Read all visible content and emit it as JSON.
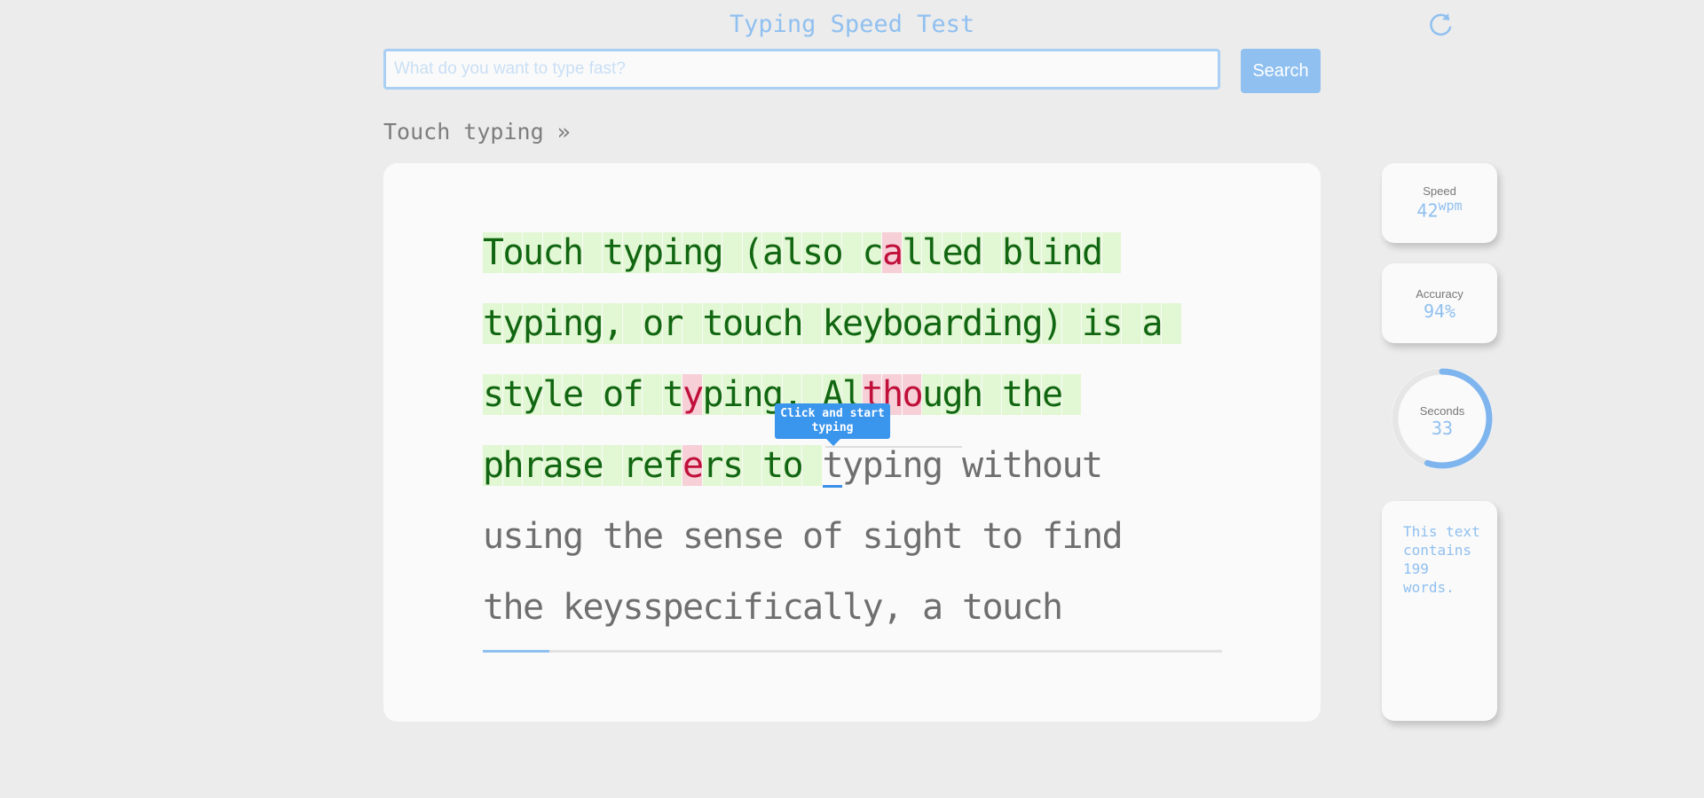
{
  "app": {
    "title": "Typing Speed Test"
  },
  "search": {
    "placeholder": "What do you want to type fast?",
    "value": "",
    "button_label": "Search"
  },
  "breadcrumb": {
    "label": "Touch typing »"
  },
  "typing": {
    "lines": [
      "Touch typing (also called blind ",
      "typing, or touch keyboarding) is a ",
      "style of typing. Although the ",
      "phrase refers to typing without",
      "using the sense of sight to find",
      "the keysspecifically, a touch"
    ],
    "typed_lines": 4,
    "typed_chars_last_line": 17,
    "errors": [
      [
        0,
        20
      ],
      [
        2,
        10
      ],
      [
        2,
        19
      ],
      [
        2,
        20
      ],
      [
        2,
        21
      ],
      [
        3,
        10
      ]
    ],
    "progress": 0.09
  },
  "tooltip": {
    "line1": "Click and start",
    "line2": "typing"
  },
  "stats": {
    "speed": {
      "label": "Speed",
      "value": "42",
      "unit": "wpm"
    },
    "accuracy": {
      "label": "Accuracy",
      "value": "94%"
    },
    "seconds": {
      "label": "Seconds",
      "value": "33",
      "fraction": 0.55
    }
  },
  "info": {
    "text": "This text contains 199 words."
  },
  "colors": {
    "accent": "#90c0f0",
    "typed": "#116611",
    "error": "#c0103a",
    "cursor": "#3a8fe8"
  },
  "icons": {
    "reload": "reload-icon"
  }
}
